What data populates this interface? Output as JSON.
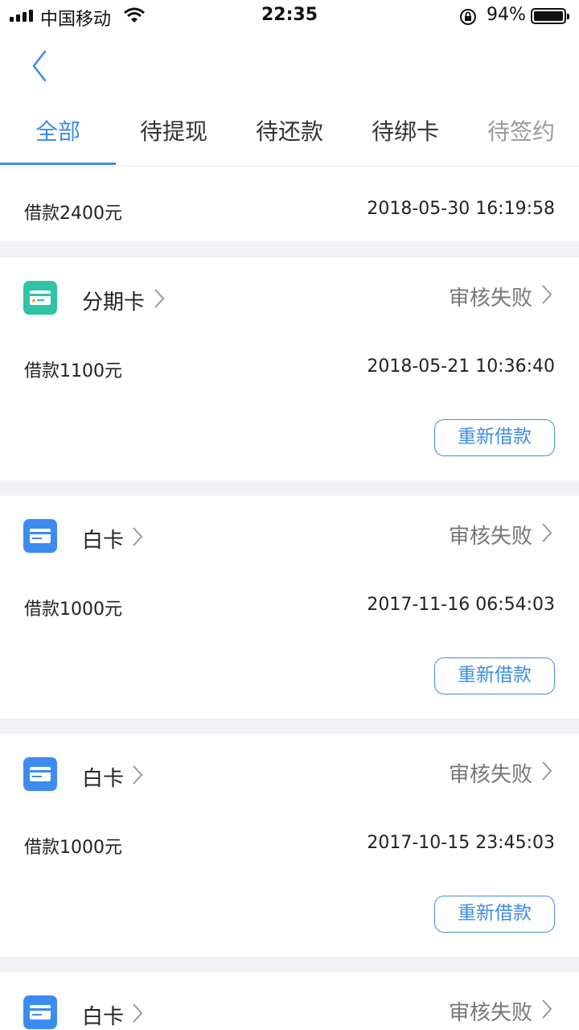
{
  "status_bar": {
    "carrier": "中国移动",
    "time": "22:35",
    "battery": "94%"
  },
  "tabs": [
    {
      "label": "全部",
      "active": true
    },
    {
      "label": "待提现"
    },
    {
      "label": "待还款"
    },
    {
      "label": "待绑卡"
    },
    {
      "label": "待签约"
    }
  ],
  "first_row": {
    "amount": "借款2400元",
    "date": "2018-05-30 16:19:58"
  },
  "records": [
    {
      "product": "分期卡",
      "icon": "installment-card-icon",
      "status": "审核失败",
      "amount": "借款1100元",
      "date": "2018-05-21 10:36:40",
      "action": "重新借款"
    },
    {
      "product": "白卡",
      "icon": "white-card-icon",
      "status": "审核失败",
      "amount": "借款1000元",
      "date": "2017-11-16 06:54:03",
      "action": "重新借款"
    },
    {
      "product": "白卡",
      "icon": "white-card-icon",
      "status": "审核失败",
      "amount": "借款1000元",
      "date": "2017-10-15 23:45:03",
      "action": "重新借款"
    },
    {
      "product": "白卡",
      "icon": "white-card-icon",
      "status": "审核失败"
    }
  ],
  "colors": {
    "accent": "#3d8bea",
    "installment_icon": "#2ec4a5",
    "white_card_icon": "#3d8bf0"
  }
}
